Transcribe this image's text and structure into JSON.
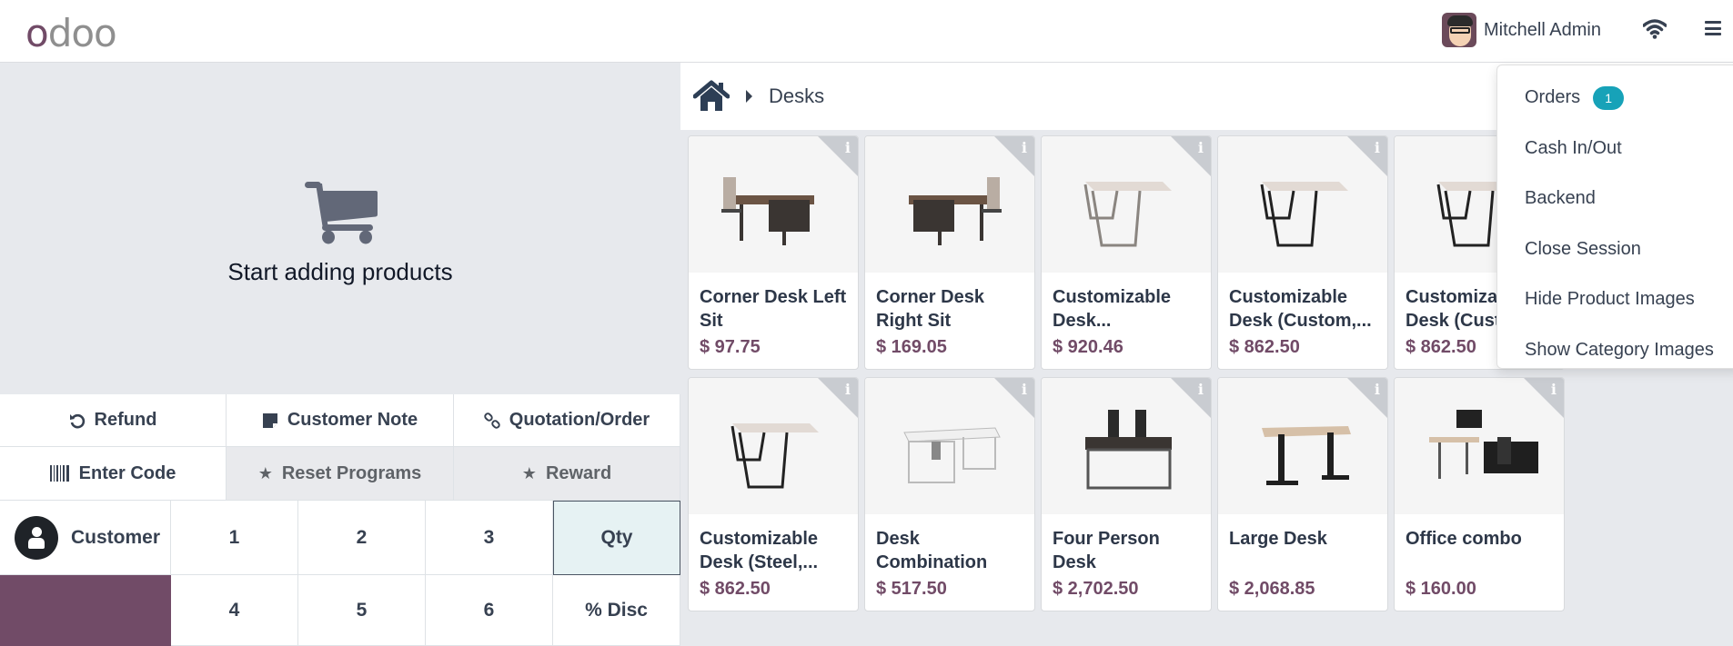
{
  "header": {
    "logo_first": "o",
    "logo_rest": "doo",
    "user_name": "Mitchell Admin",
    "icons": [
      "avatar",
      "wifi-icon",
      "hamburger-menu-icon"
    ]
  },
  "order_panel": {
    "empty_icon": "shopping-cart-icon",
    "empty_text": "Start adding products"
  },
  "control_buttons": {
    "row1": [
      {
        "label": "Refund",
        "icon": "undo-icon"
      },
      {
        "label": "Customer Note",
        "icon": "note-icon"
      },
      {
        "label": "Quotation/Order",
        "icon": "link-icon"
      }
    ],
    "row2": [
      {
        "label": "Enter Code",
        "icon": "barcode-icon"
      },
      {
        "label": "Reset Programs",
        "icon": "star-icon"
      },
      {
        "label": "Reward",
        "icon": "star-icon"
      }
    ]
  },
  "numpad": {
    "customer_label": "Customer",
    "row1": [
      "1",
      "2",
      "3",
      "Qty"
    ],
    "row2": [
      "4",
      "5",
      "6",
      "% Disc"
    ],
    "active_mode": "Qty"
  },
  "breadcrumb": {
    "home_icon": "home-icon",
    "current": "Desks"
  },
  "products": [
    {
      "name": "Corner Desk Left Sit",
      "price": "$ 97.75"
    },
    {
      "name": "Corner Desk Right Sit",
      "price": "$ 169.05"
    },
    {
      "name": "Customizable Desk...",
      "price": "$ 920.46"
    },
    {
      "name": "Customizable Desk (Custom,...",
      "price": "$ 862.50"
    },
    {
      "name": "Customizable Desk (Custom,...",
      "price": "$ 862.50"
    },
    {
      "name": "Customizable Desk (Steel,...",
      "price": "$ 862.50"
    },
    {
      "name": "Desk Combination",
      "price": "$ 517.50"
    },
    {
      "name": "Four Person Desk",
      "price": "$ 2,702.50"
    },
    {
      "name": "Large Desk",
      "price": "$ 2,068.85"
    },
    {
      "name": "Office combo",
      "price": "$ 160.00"
    }
  ],
  "menu": {
    "items": [
      {
        "label": "Orders",
        "badge": "1"
      },
      {
        "label": "Cash In/Out"
      },
      {
        "label": "Backend"
      },
      {
        "label": "Close Session"
      },
      {
        "label": "Hide Product Images"
      },
      {
        "label": "Show Category Images"
      }
    ]
  },
  "colors": {
    "brand": "#714b67",
    "badge": "#17a2b8",
    "qty_active_bg": "#e6f2f3",
    "panel_bg": "#e7e9ed"
  }
}
